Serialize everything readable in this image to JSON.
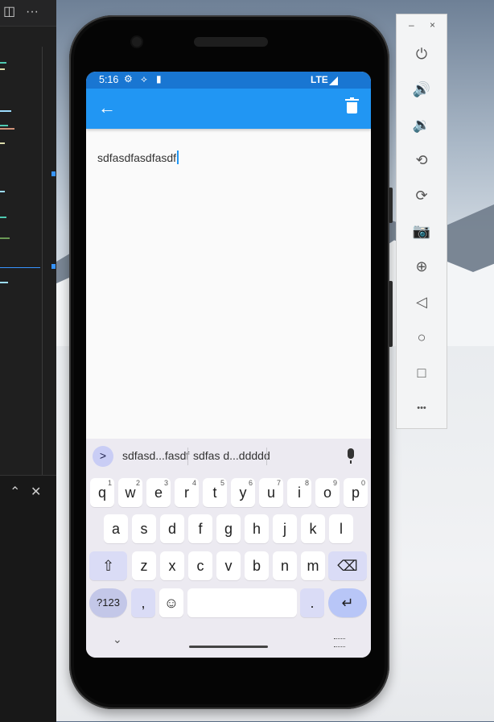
{
  "status": {
    "time": "5:16",
    "network": "LTE"
  },
  "appbar": {
    "back_icon": "arrow-left-icon",
    "delete_icon": "trash-icon"
  },
  "editor": {
    "text": "sdfasdfasdfasdf"
  },
  "keyboard": {
    "suggestions": [
      "sdfasd...fasdf",
      "sdfas d...ddddd"
    ],
    "row1": [
      {
        "k": "q",
        "s": "1"
      },
      {
        "k": "w",
        "s": "2"
      },
      {
        "k": "e",
        "s": "3"
      },
      {
        "k": "r",
        "s": "4"
      },
      {
        "k": "t",
        "s": "5"
      },
      {
        "k": "y",
        "s": "6"
      },
      {
        "k": "u",
        "s": "7"
      },
      {
        "k": "i",
        "s": "8"
      },
      {
        "k": "o",
        "s": "9"
      },
      {
        "k": "p",
        "s": "0"
      }
    ],
    "row2": [
      "a",
      "s",
      "d",
      "f",
      "g",
      "h",
      "j",
      "k",
      "l"
    ],
    "row3": [
      "z",
      "x",
      "c",
      "v",
      "b",
      "n",
      "m"
    ],
    "symbols_label": "?123",
    "comma_label": ",",
    "period_label": ".",
    "shift_icon": "shift-arrow-icon",
    "backspace_icon": "backspace-icon",
    "enter_icon": "enter-arrow-icon",
    "emoji_icon": "emoji-icon",
    "expand_icon": "chevron-right-icon",
    "mic_icon": "microphone-icon"
  },
  "emulator_toolbar": {
    "minimize_label": "–",
    "close_label": "×",
    "tools": [
      {
        "name": "power-icon",
        "glyph": "⏻"
      },
      {
        "name": "volume-up-icon",
        "glyph": "🔊"
      },
      {
        "name": "volume-down-icon",
        "glyph": "🔉"
      },
      {
        "name": "rotate-left-icon",
        "glyph": "⟲"
      },
      {
        "name": "rotate-right-icon",
        "glyph": "⟳"
      },
      {
        "name": "camera-icon",
        "glyph": "📷"
      },
      {
        "name": "zoom-icon",
        "glyph": "⊕"
      },
      {
        "name": "back-icon",
        "glyph": "◁"
      },
      {
        "name": "home-icon",
        "glyph": "○"
      },
      {
        "name": "overview-icon",
        "glyph": "□"
      },
      {
        "name": "more-icon",
        "glyph": "•••"
      }
    ]
  },
  "colors": {
    "statusbar": "#1976d2",
    "appbar": "#2196f3",
    "keyboard_bg": "#eceaf1",
    "accent_key": "#b8c6f7"
  }
}
